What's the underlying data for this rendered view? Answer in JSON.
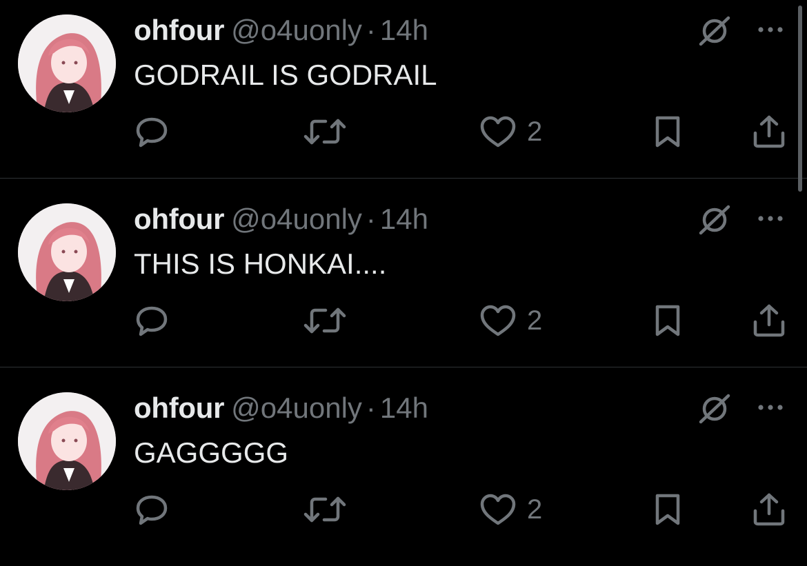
{
  "feed": {
    "tweets": [
      {
        "display_name": "ohfour",
        "handle": "@o4uonly",
        "separator": "·",
        "time": "14h",
        "text": "GODRAIL IS GODRAIL",
        "likes": "2"
      },
      {
        "display_name": "ohfour",
        "handle": "@o4uonly",
        "separator": "·",
        "time": "14h",
        "text": "THIS IS HONKAI....",
        "likes": "2"
      },
      {
        "display_name": "ohfour",
        "handle": "@o4uonly",
        "separator": "·",
        "time": "14h",
        "text": "GAGGGGG",
        "likes": "2"
      }
    ]
  },
  "icons": {
    "reply": "reply-icon",
    "retweet": "retweet-icon",
    "like": "heart-icon",
    "bookmark": "bookmark-icon",
    "share": "share-icon",
    "grok": "grok-icon",
    "more": "more-icon"
  },
  "colors": {
    "background": "#000000",
    "primary_text": "#e7e9ea",
    "secondary_text": "#71767b",
    "divider": "#2f3336",
    "avatar_hair": "#d97a86"
  }
}
